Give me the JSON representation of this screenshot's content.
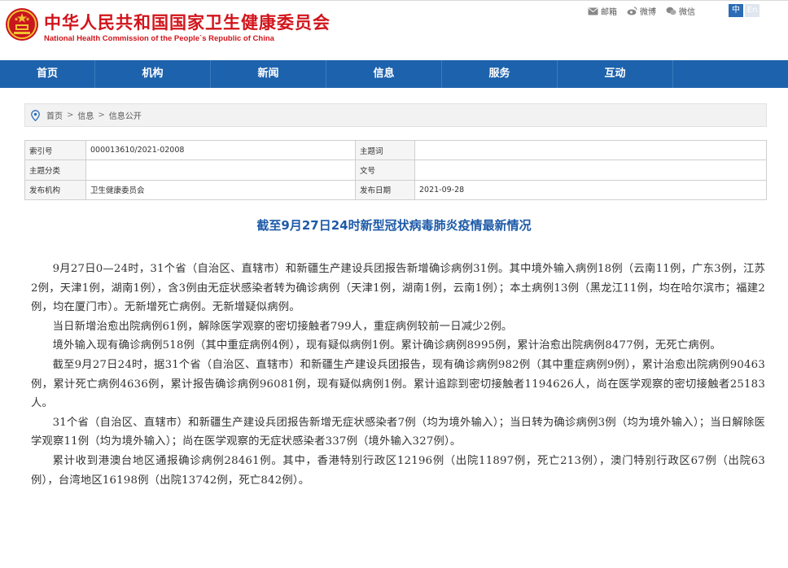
{
  "header": {
    "title_cn": "中华人民共和国国家卫生健康委员会",
    "title_en": "National Health Commission of the People`s Republic of China",
    "links": [
      {
        "icon": "mail-icon",
        "label": "邮箱"
      },
      {
        "icon": "weibo-icon",
        "label": "微博"
      },
      {
        "icon": "wechat-icon",
        "label": "微信"
      }
    ],
    "lang_cn": "中",
    "lang_en": "En"
  },
  "nav": {
    "items": [
      "首页",
      "机构",
      "新闻",
      "信息",
      "服务",
      "互动"
    ]
  },
  "breadcrumb": [
    "首页",
    "信息",
    "信息公开"
  ],
  "meta": {
    "index_label": "索引号",
    "index_value": "000013610/2021-02008",
    "subject_label": "主题词",
    "subject_value": "",
    "category_label": "主题分类",
    "category_value": "",
    "docno_label": "文号",
    "docno_value": "",
    "issuer_label": "发布机构",
    "issuer_value": "卫生健康委员会",
    "date_label": "发布日期",
    "date_value": "2021-09-28"
  },
  "article": {
    "title": "截至9月27日24时新型冠状病毒肺炎疫情最新情况",
    "paragraphs": [
      "9月27日0—24时，31个省（自治区、直辖市）和新疆生产建设兵团报告新增确诊病例31例。其中境外输入病例18例（云南11例，广东3例，江苏2例，天津1例，湖南1例），含3例由无症状感染者转为确诊病例（天津1例，湖南1例，云南1例）；本土病例13例（黑龙江11例，均在哈尔滨市；福建2例，均在厦门市）。无新增死亡病例。无新增疑似病例。",
      "当日新增治愈出院病例61例，解除医学观察的密切接触者799人，重症病例较前一日减少2例。",
      "境外输入现有确诊病例518例（其中重症病例4例），现有疑似病例1例。累计确诊病例8995例，累计治愈出院病例8477例，无死亡病例。",
      "截至9月27日24时，据31个省（自治区、直辖市）和新疆生产建设兵团报告，现有确诊病例982例（其中重症病例9例），累计治愈出院病例90463例，累计死亡病例4636例，累计报告确诊病例96081例，现有疑似病例1例。累计追踪到密切接触者1194626人，尚在医学观察的密切接触者25183人。",
      "31个省（自治区、直辖市）和新疆生产建设兵团报告新增无症状感染者7例（均为境外输入）；当日转为确诊病例3例（均为境外输入）；当日解除医学观察11例（均为境外输入）；尚在医学观察的无症状感染者337例（境外输入327例）。",
      "累计收到港澳台地区通报确诊病例28461例。其中，香港特别行政区12196例（出院11897例，死亡213例），澳门特别行政区67例（出院63例），台湾地区16198例（出院13742例，死亡842例）。"
    ]
  },
  "colors": {
    "brand_red": "#d1141b",
    "nav_blue": "#1d62ac",
    "title_blue": "#1d5aa8"
  }
}
